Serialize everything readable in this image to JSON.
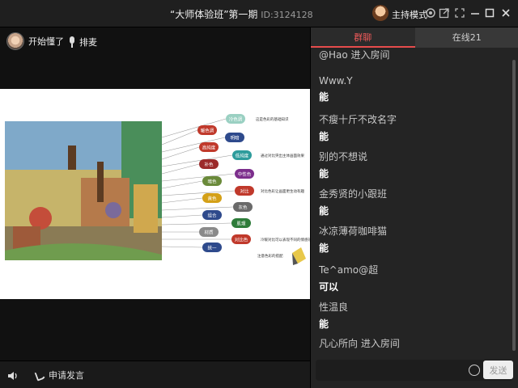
{
  "window": {
    "title": "“大师体验班”第一期",
    "room_id": "ID:3124128",
    "host_mode_label": "主持模式"
  },
  "stage": {
    "teacher_status": "开始懂了",
    "mic_label": "排麦",
    "apply_label": "申请发言"
  },
  "slide": {
    "labels": [
      "冷色调",
      "暖色调",
      "明暗",
      "高纯度",
      "低纯度",
      "补色",
      "中性色",
      "暗色",
      "对比",
      "黄色",
      "灰色",
      "组合",
      "肌理",
      "材质",
      "对比色",
      "统一"
    ],
    "notes": [
      "这是色彩的基础知识",
      "通过对比突出主体画面效果",
      "对比色彩让画面更生动有趣",
      "冷暖对比可以表现不同的情感效果",
      "注意色彩的搭配"
    ]
  },
  "chat": {
    "tab_group": "群聊",
    "tab_online": "在线21",
    "messages": [
      {
        "user": "@Hao 进入房间",
        "text": ""
      },
      {
        "user": "Www.Y",
        "text": "能"
      },
      {
        "user": "不瘦十斤不改名字",
        "text": "能"
      },
      {
        "user": "别的不想说",
        "text": "能"
      },
      {
        "user": "金秀贤的小跟班",
        "text": "能"
      },
      {
        "user": "冰凉薄荷咖啡猫",
        "text": "能"
      },
      {
        "user": "Te^amo@超",
        "text": "可以"
      },
      {
        "user": "性温良",
        "text": "能"
      },
      {
        "user": "凡心所向 进入房间",
        "text": ""
      }
    ],
    "input_placeholder": "",
    "send_label": "发送"
  }
}
